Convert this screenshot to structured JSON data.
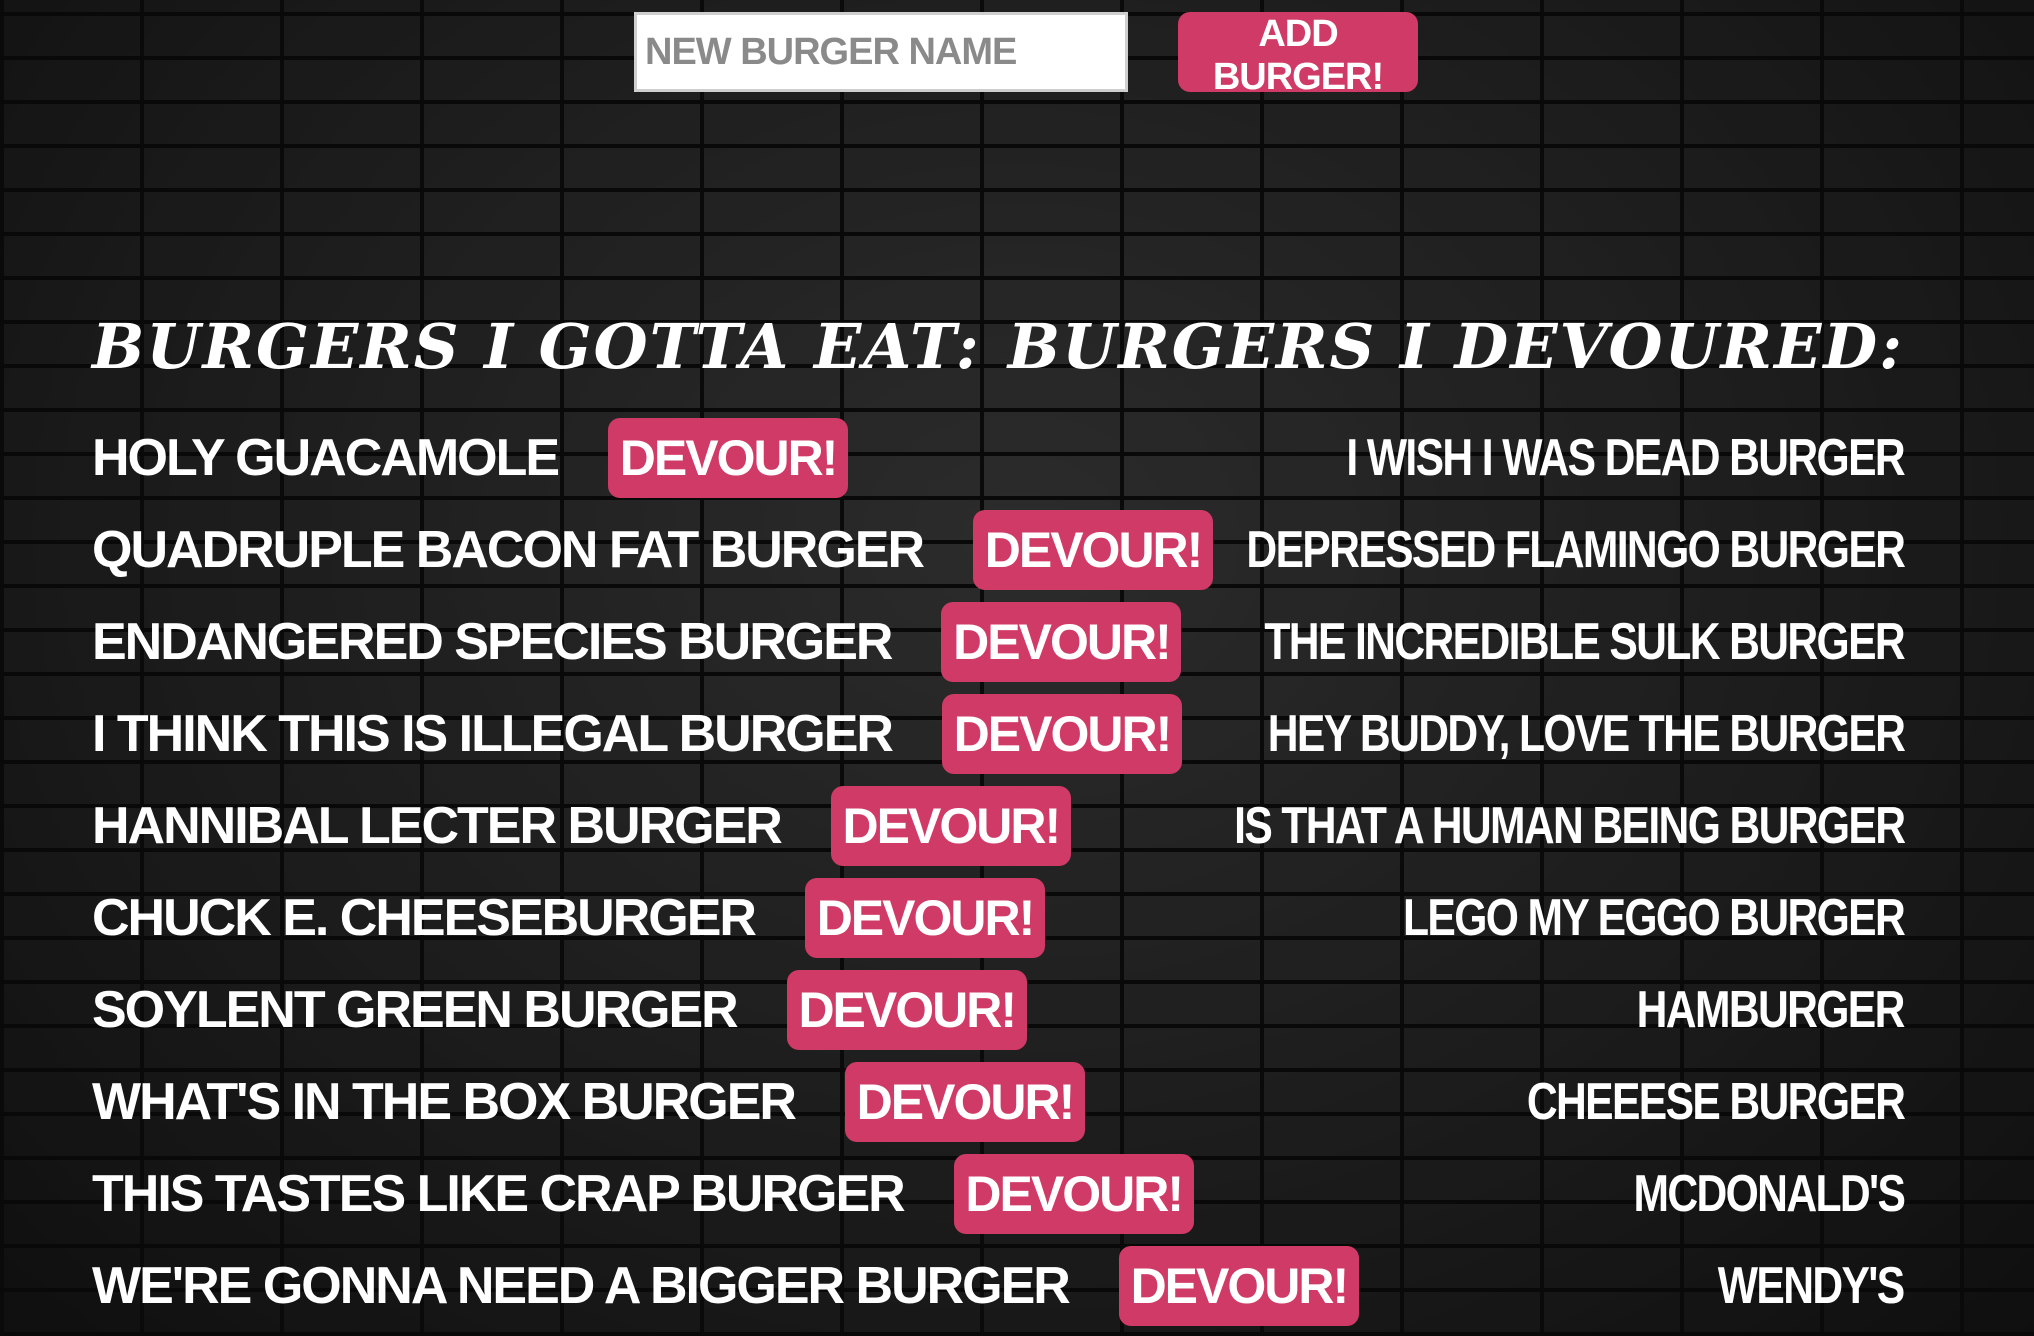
{
  "form": {
    "input_placeholder": "NEW BURGER NAME",
    "add_button_label": "ADD BURGER!"
  },
  "left_column": {
    "heading": "BURGERS I GOTTA EAT:",
    "devour_label": "DEVOUR!",
    "burgers": [
      "HOLY GUACAMOLE",
      "QUADRUPLE BACON FAT BURGER",
      "ENDANGERED SPECIES BURGER",
      "I THINK THIS IS ILLEGAL BURGER",
      "HANNIBAL LECTER BURGER",
      "CHUCK E. CHEESEBURGER",
      "SOYLENT GREEN BURGER",
      "WHAT'S IN THE BOX BURGER",
      "THIS TASTES LIKE CRAP BURGER",
      "WE'RE GONNA NEED A BIGGER BURGER"
    ]
  },
  "right_column": {
    "heading": "BURGERS I DEVOURED:",
    "burgers": [
      "I WISH I WAS DEAD BURGER",
      "DEPRESSED FLAMINGO BURGER",
      "THE INCREDIBLE SULK BURGER",
      "HEY BUDDY, LOVE THE BURGER",
      "IS THAT A HUMAN BEING BURGER",
      "LEGO MY EGGO BURGER",
      "HAMBURGER",
      "CHEEESE BURGER",
      "MCDONALD'S",
      "WENDY'S"
    ]
  },
  "colors": {
    "button_bg": "#d03a66",
    "text": "#ffffff"
  }
}
